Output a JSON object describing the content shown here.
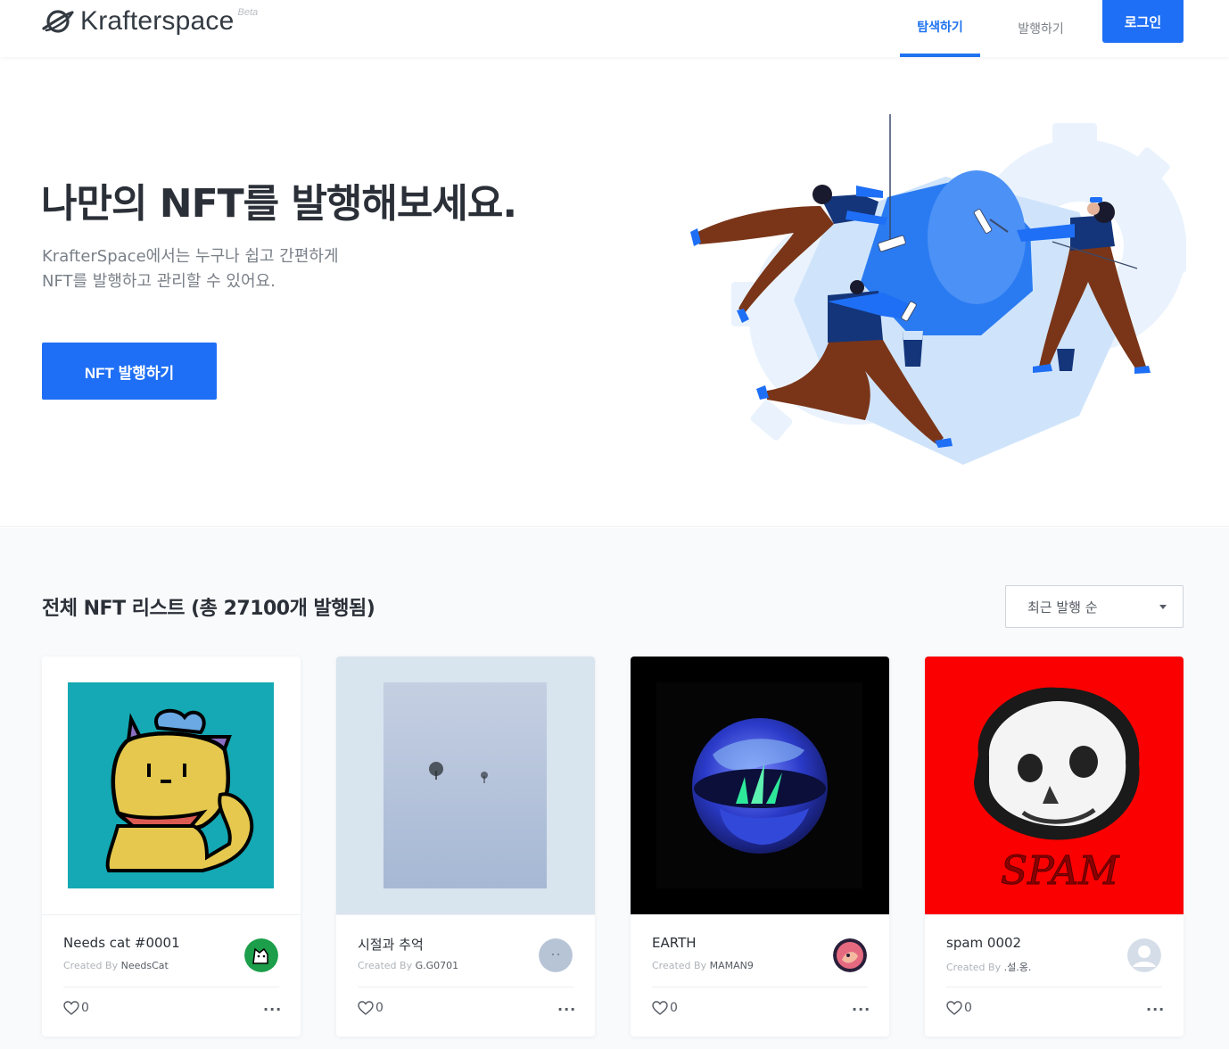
{
  "header": {
    "logo_text": "Krafterspace",
    "beta_label": "Beta",
    "tabs": [
      {
        "label": "탐색하기",
        "active": true
      },
      {
        "label": "발행하기",
        "active": false
      }
    ],
    "login_label": "로그인"
  },
  "hero": {
    "title": "나만의 NFT를 발행해보세요.",
    "desc_line1": "KrafterSpace에서는 누구나 쉽고 간편하게",
    "desc_line2": "NFT를 발행하고 관리할 수 있어요.",
    "cta_label": "NFT 발행하기"
  },
  "list": {
    "title": "전체 NFT 리스트 (총 27100개 발행됨)",
    "sort_selected": "최근 발행 순",
    "cards": [
      {
        "name": "Needs cat #0001",
        "created_by_prefix": "Created By",
        "creator": "NeedsCat",
        "likes": "0",
        "more": "···"
      },
      {
        "name": "시절과 추억",
        "created_by_prefix": "Created By",
        "creator": "G.G0701",
        "likes": "0",
        "more": "···"
      },
      {
        "name": "EARTH",
        "created_by_prefix": "Created By",
        "creator": "MAMAN9",
        "likes": "0",
        "more": "···"
      },
      {
        "name": "spam 0002",
        "created_by_prefix": "Created By",
        "creator": ".설.옹.",
        "likes": "0",
        "more": "···"
      }
    ]
  },
  "colors": {
    "accent": "#1e6ff5",
    "text_dark": "#2b3038",
    "text_muted": "#7a8088",
    "section_bg": "#f8fafc"
  },
  "icons": [
    "planet-logo-icon",
    "heart-icon",
    "more-dots-icon",
    "dropdown-caret-icon"
  ]
}
